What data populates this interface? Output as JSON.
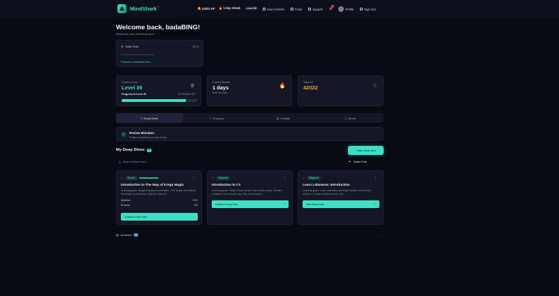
{
  "nav": {
    "logo": "MindShark",
    "logo_mark": "™",
    "xp": "42022 XP",
    "streak": "1 day streak",
    "level": "Level 39",
    "links": [
      "How It Works",
      "FAQs",
      "Support"
    ],
    "profile": "Profile",
    "sign_out": "Sign Out"
  },
  "header": {
    "title": "Welcome back, badaBING!",
    "subtitle": "Ready for your next deep dive?"
  },
  "daily_goal": {
    "label": "Daily Goal",
    "value": "0 / 4",
    "link": "Pokemon: Unleashed Sho..."
  },
  "stats": {
    "level_label": "Current Level",
    "level_value": "Level 39",
    "progress_label": "Progress to Level 40",
    "progress_value": "11722/2000 XP",
    "progress_fraction": 0.85,
    "streak_label": "Current Streak",
    "streak_value": "1 days",
    "streak_sub": "Best: 84 days",
    "xp_label": "Total XP",
    "xp_value": "42022"
  },
  "tabs": [
    "Deep Dives",
    "Progress",
    "Insights",
    "Board"
  ],
  "review": {
    "title": "Review Mistakes",
    "sub": "Practice questions you got wrong"
  },
  "deep_dives": {
    "title": "My Deep Dives",
    "count": "3",
    "new_button": "+ New Deep Dive",
    "search_placeholder": "Search Deep Dives...",
    "filter": "Active First",
    "items": [
      {
        "tags": [
          "Novice",
          ""
        ],
        "title": "Introduction to The Way of Kings Magic",
        "desc": "Learning goals: Surgebinding core principles, The Surges and effects, Stormlight as backstory. Opened: Who do...",
        "meta1_label": "Modules",
        "meta1_value": "0/10",
        "meta2_label": "Process",
        "meta2_value": "0%",
        "button": "Continue Deep Dive"
      },
      {
        "tags": [
          "Beginner"
        ],
        "title": "Introduction to C#",
        "desc": "Learning goals: Install Visual Studio, Learn basic syntax, Declare variables, Use Console app, Run first program...",
        "button": "Continue Deep Dive"
      },
      {
        "tags": [
          "Beginner"
        ],
        "title": "Learn Lebanese: Introduction",
        "desc": "Learning goals: Learn Lebanese greetings, Master basic family phrases, Practice numbers to ten, Intr...",
        "button": "Start Deep Dive"
      }
    ]
  },
  "archived": {
    "label": "Archived",
    "count": "0"
  }
}
